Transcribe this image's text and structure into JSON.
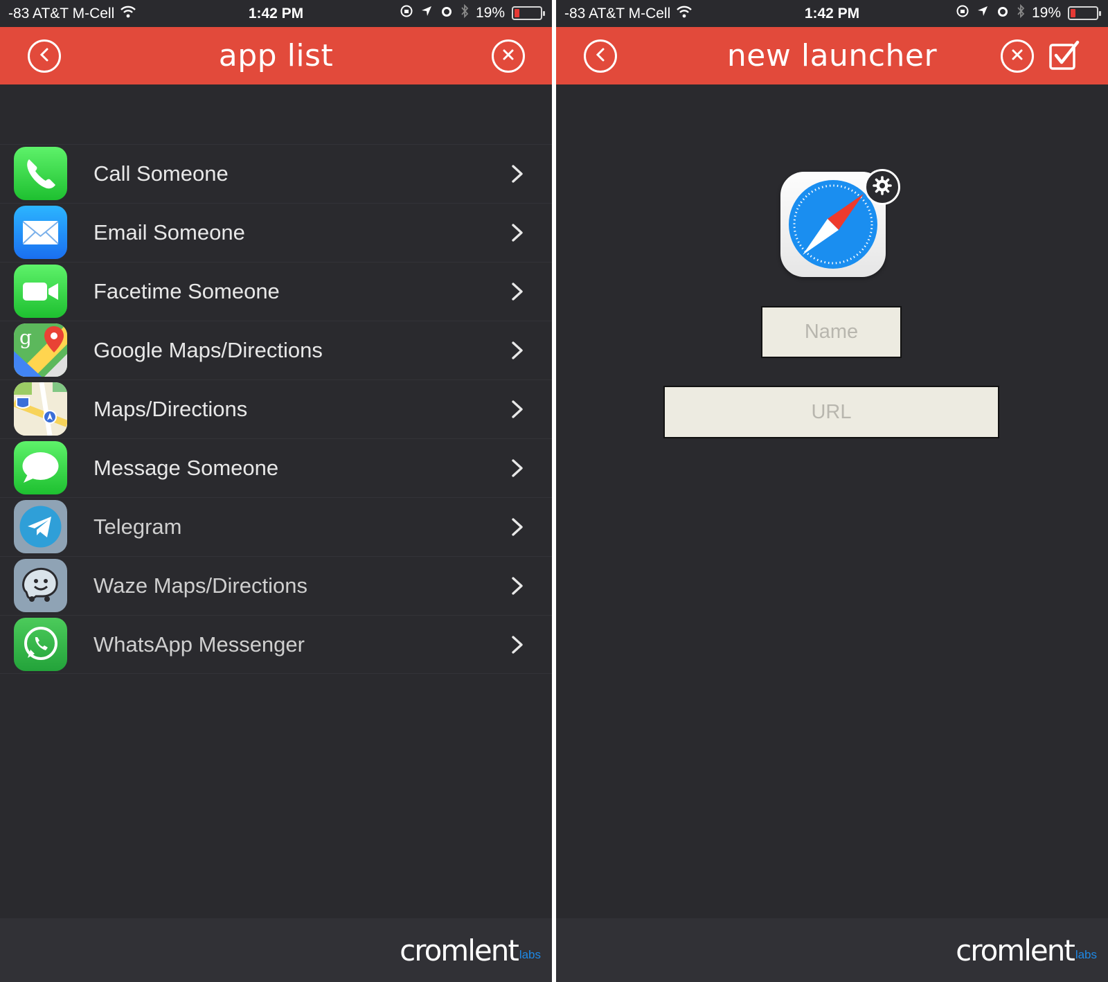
{
  "status": {
    "carrier": "-83 AT&T M-Cell",
    "time": "1:42 PM",
    "battery": "19%",
    "battery_level": 0.19,
    "battery_color": "#e53935"
  },
  "left": {
    "title": "app list",
    "back_icon": "chevron-left-circle-icon",
    "close_icon": "close-circle-icon",
    "apps": [
      {
        "label": "Call Someone",
        "icon": "phone-icon"
      },
      {
        "label": "Email Someone",
        "icon": "mail-icon"
      },
      {
        "label": "Facetime Someone",
        "icon": "facetime-icon"
      },
      {
        "label": "Google Maps/Directions",
        "icon": "google-maps-icon"
      },
      {
        "label": "Maps/Directions",
        "icon": "maps-icon"
      },
      {
        "label": "Message Someone",
        "icon": "messages-icon"
      },
      {
        "label": "Telegram",
        "icon": "telegram-icon"
      },
      {
        "label": "Waze Maps/Directions",
        "icon": "waze-icon"
      },
      {
        "label": "WhatsApp Messenger",
        "icon": "whatsapp-icon"
      }
    ]
  },
  "right": {
    "title": "new launcher",
    "app_icon": "safari-compass-icon",
    "settings_icon": "gear-icon",
    "name_placeholder": "Name",
    "url_placeholder": "URL"
  },
  "footer": {
    "logo_text": "cromlent",
    "logo_suffix": "labs"
  },
  "colors": {
    "nav_red": "#e24a3b",
    "background": "#2a2a2e",
    "footer": "#313136"
  }
}
